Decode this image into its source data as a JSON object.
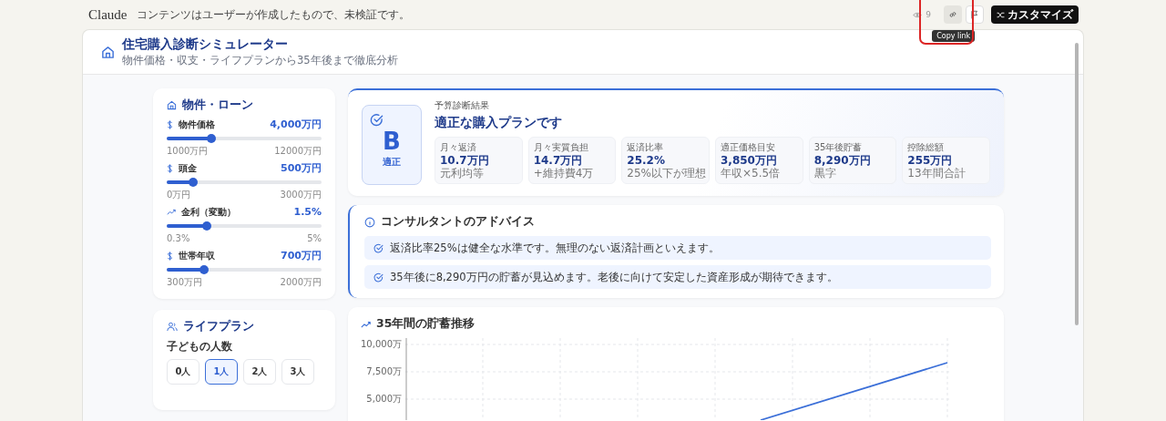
{
  "topbar": {
    "brand": "Claude",
    "notice": "コンテンツはユーザーが作成したもので、未検証です。",
    "views": "9",
    "tooltip": "Copy link",
    "customize": "カスタマイズ"
  },
  "header": {
    "title": "住宅購入診断シミュレーター",
    "subtitle": "物件価格・収支・ライフプランから35年後まで徹底分析"
  },
  "loan": {
    "title": "物件・ローン",
    "sliders": [
      {
        "label": "物件価格",
        "value": "4,000万円",
        "level": 0.29,
        "min": "1000万円",
        "max": "12000万円"
      },
      {
        "label": "頭金",
        "value": "500万円",
        "level": 0.17,
        "min": "0万円",
        "max": "3000万円"
      },
      {
        "label": "金利（変動）",
        "value": "1.5%",
        "level": 0.26,
        "min": "0.3%",
        "max": "5%"
      },
      {
        "label": "世帯年収",
        "value": "700万円",
        "level": 0.24,
        "min": "300万円",
        "max": "2000万円"
      }
    ]
  },
  "lifeplan": {
    "title": "ライフプラン",
    "children_label": "子どもの人数",
    "options": [
      {
        "label": "0人",
        "selected": false
      },
      {
        "label": "1人",
        "selected": true
      },
      {
        "label": "2人",
        "selected": false
      },
      {
        "label": "3人",
        "selected": false
      }
    ]
  },
  "result": {
    "grade": "B",
    "grade_label": "適正",
    "caption": "予算診断結果",
    "headline": "適正な購入プランです",
    "stats": [
      {
        "label": "月々返済",
        "value": "10.7万円",
        "note": "元利均等"
      },
      {
        "label": "月々実質負担",
        "value": "14.7万円",
        "note": "+維持費4万"
      },
      {
        "label": "返済比率",
        "value": "25.2%",
        "note": "25%以下が理想"
      },
      {
        "label": "適正価格目安",
        "value": "3,850万円",
        "note": "年収×5.5倍"
      },
      {
        "label": "35年後貯蓄",
        "value": "8,290万円",
        "note": "黒字"
      },
      {
        "label": "控除総額",
        "value": "255万円",
        "note": "13年間合計"
      }
    ]
  },
  "advice": {
    "title": "コンサルタントのアドバイス",
    "items": [
      "返済比率25%は健全な水準です。無理のない返済計画といえます。",
      "35年後に8,290万円の貯蓄が見込めます。老後に向けて安定した資産形成が期待できます。"
    ]
  },
  "savings": {
    "title": "35年間の貯蓄推移",
    "axis_labels": [
      "10,000万",
      "7,500万",
      "5,000万"
    ]
  }
}
